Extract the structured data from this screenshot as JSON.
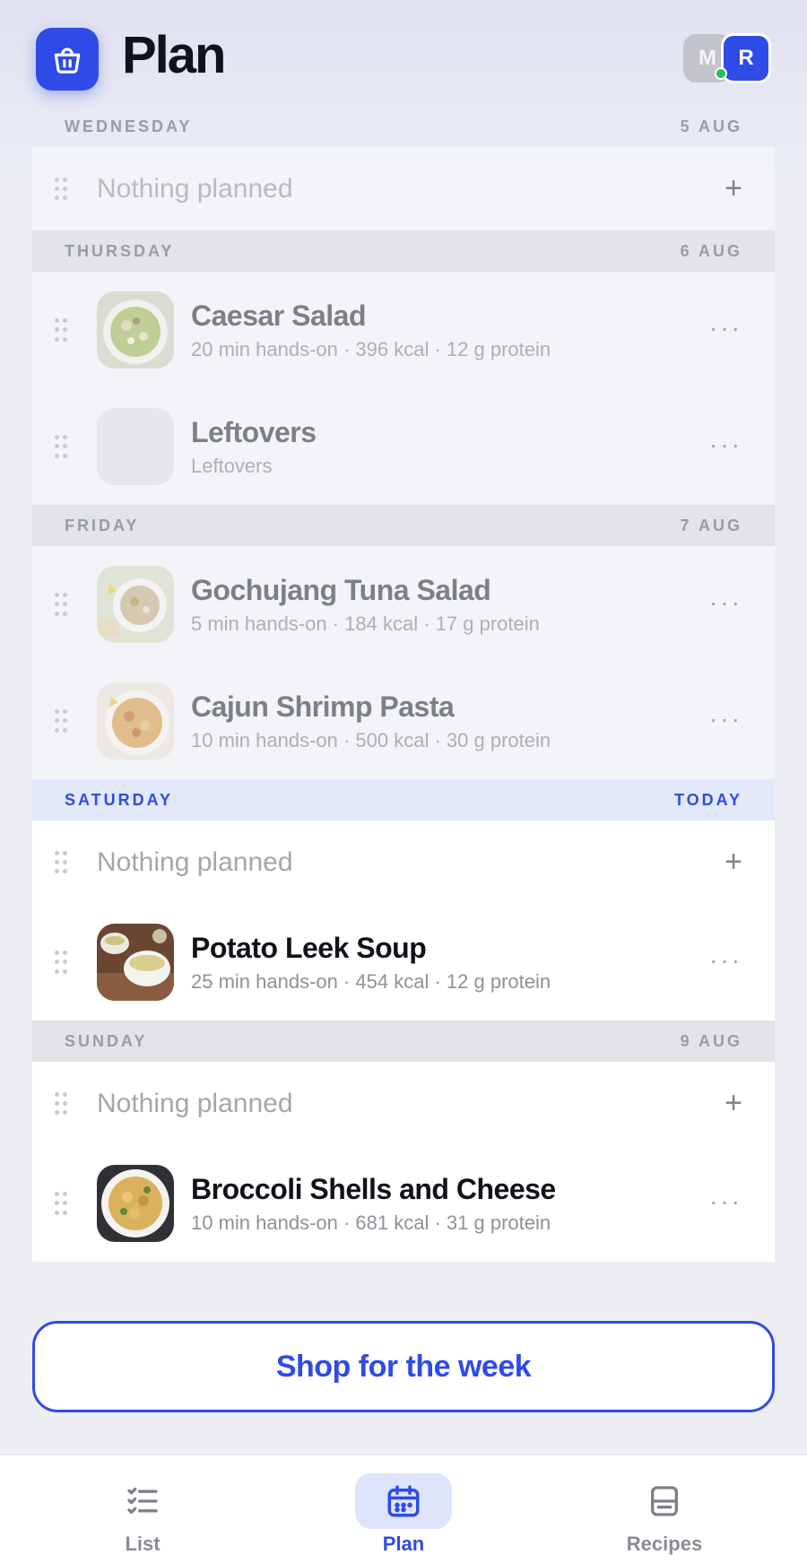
{
  "app": {
    "title": "Plan"
  },
  "header": {
    "avatars": [
      "M",
      "R"
    ]
  },
  "days": [
    {
      "day": "WEDNESDAY",
      "date": "5 AUG",
      "items": [
        {
          "empty": true,
          "text": "Nothing planned"
        }
      ]
    },
    {
      "day": "THURSDAY",
      "date": "6 AUG",
      "items": [
        {
          "title": "Caesar Salad",
          "sub": "20 min hands-on · 396 kcal · 12 g protein"
        },
        {
          "title": "Leftovers",
          "sub": "Leftovers"
        }
      ]
    },
    {
      "day": "FRIDAY",
      "date": "7 AUG",
      "items": [
        {
          "title": "Gochujang Tuna Salad",
          "sub": "5 min hands-on · 184 kcal · 17 g protein"
        },
        {
          "title": "Cajun Shrimp Pasta",
          "sub": "10 min hands-on · 500 kcal · 30 g protein"
        }
      ]
    },
    {
      "day": "SATURDAY",
      "date": "TODAY",
      "items": [
        {
          "empty": true,
          "text": "Nothing planned"
        },
        {
          "title": "Potato Leek Soup",
          "sub": "25 min hands-on · 454 kcal · 12 g protein"
        }
      ]
    },
    {
      "day": "SUNDAY",
      "date": "9 AUG",
      "items": [
        {
          "empty": true,
          "text": "Nothing planned"
        },
        {
          "title": "Broccoli Shells and Cheese",
          "sub": "10 min hands-on · 681 kcal · 31 g protein"
        }
      ]
    }
  ],
  "actions": {
    "shop_label": "Shop for the week",
    "more_glyph": "···",
    "add_glyph": "+"
  },
  "nav": {
    "list": "List",
    "plan": "Plan",
    "recipes": "Recipes",
    "active": "plan"
  },
  "colors": {
    "accent": "#2f4be8",
    "today_bg": "#e2e9fb",
    "online": "#2dbd5a"
  },
  "icons": {
    "logo": "basket-icon",
    "list": "checklist-icon",
    "plan": "calendar-icon",
    "recipes": "recipe-card-icon"
  }
}
